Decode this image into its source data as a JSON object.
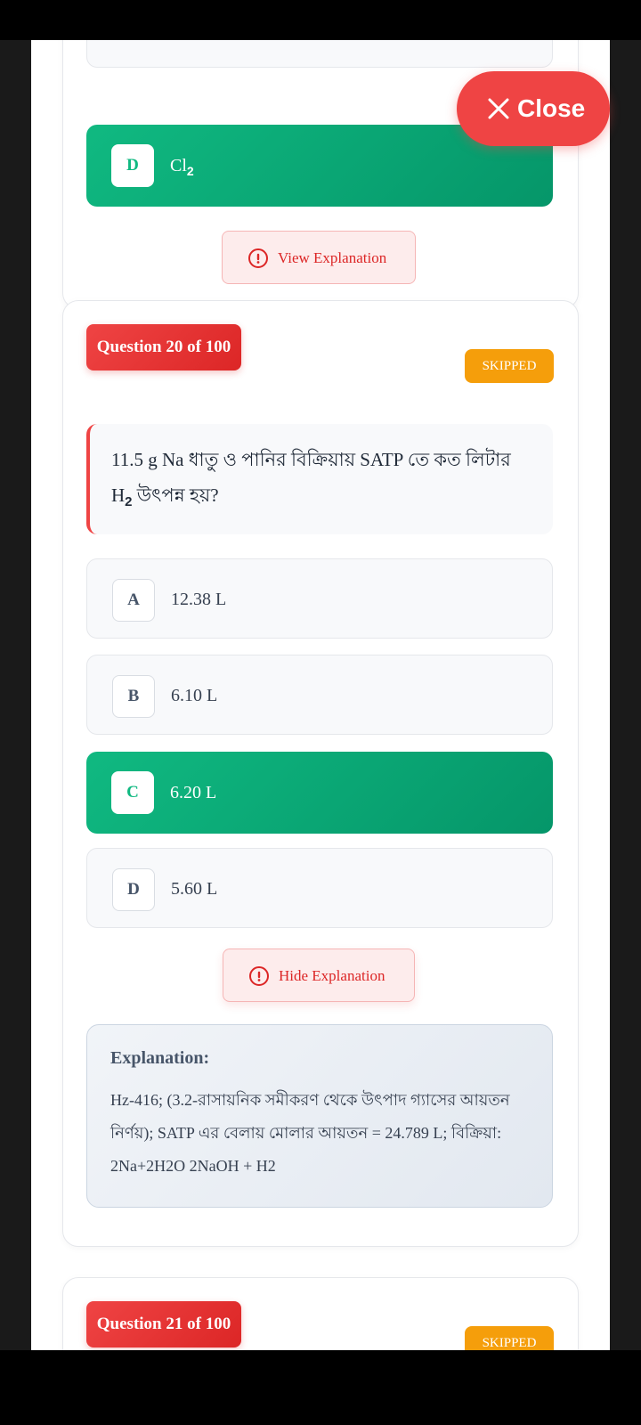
{
  "close_button": {
    "label": "Close"
  },
  "prev_card": {
    "option_d": {
      "letter": "D",
      "text_main": "Cl",
      "text_sub": "2"
    },
    "explanation_button": "View Explanation"
  },
  "question_20": {
    "badge": "Question 20 of 100",
    "status": "SKIPPED",
    "question_text": "11.5 g Na ধাতু ও পানির বিক্রিয়ায় SATP তে কত লিটার H",
    "question_sub": "2",
    "question_text_end": " উৎপন্ন হয়?",
    "options": [
      {
        "letter": "A",
        "text": "12.38 L"
      },
      {
        "letter": "B",
        "text": "6.10 L"
      },
      {
        "letter": "C",
        "text": "6.20 L"
      },
      {
        "letter": "D",
        "text": "5.60 L"
      }
    ],
    "correct_option": "C",
    "explanation_button": "Hide Explanation",
    "explanation": {
      "title": "Explanation:",
      "body": "Hz-416; (3.2-রাসায়নিক সমীকরণ থেকে উৎপাদ গ্যাসের আয়তন নির্ণয়); SATP এর বেলায় মোলার আয়তন = 24.789 L; বিক্রিয়া: 2Na+2H2O 2NaOH + H2"
    }
  },
  "question_21": {
    "badge": "Question 21 of 100",
    "status": "SKIPPED"
  },
  "colors": {
    "correct": "#10b981",
    "danger": "#ef4444",
    "skipped": "#f59e0b"
  }
}
